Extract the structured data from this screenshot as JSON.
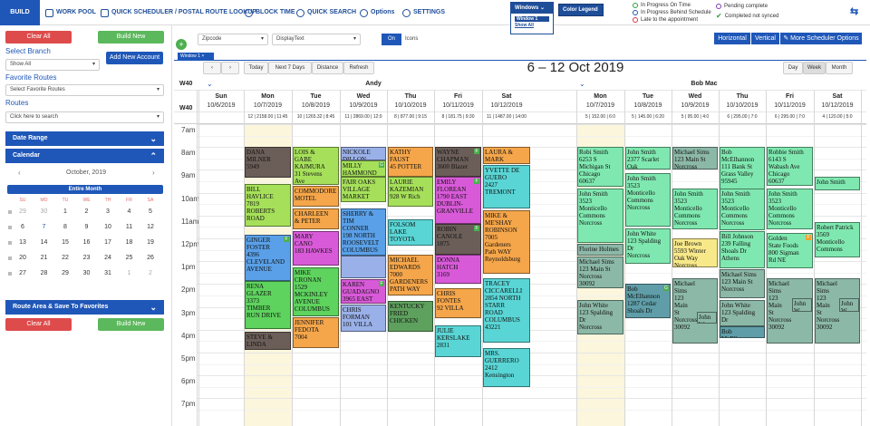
{
  "topnav": {
    "build": "BUILD",
    "items": [
      "WORK POOL",
      "QUICK SCHEDULER / POSTAL ROUTE LOOKUP",
      "BLOCK TIME",
      "QUICK SEARCH",
      "Options",
      "SETTINGS"
    ]
  },
  "windows_popup": {
    "title": "Windows",
    "items": [
      "Window 1",
      "Show All"
    ]
  },
  "color_legend": {
    "title": "Color Legend"
  },
  "status_legend": [
    {
      "text": "In Progress On Time",
      "color": "#2e9e3a"
    },
    {
      "text": "In Progress Behind Schedule",
      "color": "#1f57b8"
    },
    {
      "text": "Late to the appointment",
      "color": "#d9363e"
    },
    {
      "text": "Pending complete",
      "color": "#7a3fb0"
    },
    {
      "text": "Completed not synced",
      "color": "#2e9e3a"
    }
  ],
  "left": {
    "clear_all": "Clear All",
    "build_new": "Build New",
    "select_branch_label": "Select Branch",
    "branch_value": "Show All",
    "add_new_account": "Add New Account",
    "favorite_routes_label": "Favorite Routes",
    "favorite_placeholder": "Select Favorite Routes",
    "routes_label": "Routes",
    "routes_placeholder": "Click here to search",
    "date_range": "Date Range",
    "calendar": "Calendar",
    "month_title": "October, 2019",
    "entire_month": "Entire Month",
    "weekdays": [
      "SU",
      "MO",
      "TU",
      "WE",
      "TH",
      "FR",
      "SA"
    ],
    "weeks": [
      [
        "29",
        "30",
        "1",
        "2",
        "3",
        "4",
        "5"
      ],
      [
        "6",
        "7",
        "8",
        "9",
        "10",
        "11",
        "12"
      ],
      [
        "13",
        "14",
        "15",
        "16",
        "17",
        "18",
        "19"
      ],
      [
        "20",
        "21",
        "22",
        "23",
        "24",
        "25",
        "26"
      ],
      [
        "27",
        "28",
        "29",
        "30",
        "31",
        "1",
        "2"
      ]
    ],
    "route_area_save": "Route Area & Save To Favorites",
    "clear_all_2": "Clear All",
    "build_new_2": "Build New"
  },
  "filter": {
    "zipcode": "Zipcode",
    "displaytext": "DisplayText",
    "on": "On",
    "icons": "Icons",
    "views": [
      "Horizontal",
      "Vertical",
      "More Scheduler Options"
    ]
  },
  "window_tab": "Window 1",
  "calendar_toolbar": {
    "buttons": [
      "Today",
      "Next 7 Days",
      "Distance",
      "Refresh"
    ],
    "title": "6 – 12 Oct 2019",
    "views": [
      "Day",
      "Week",
      "Month"
    ]
  },
  "technicians": [
    {
      "name": "Andy",
      "days": [
        {
          "day": "Sun",
          "date": "10/6/2019",
          "stats": ""
        },
        {
          "day": "Mon",
          "date": "10/7/2019",
          "stats": "12 | 2158.00 | 11:45"
        },
        {
          "day": "Tue",
          "date": "10/8/2019",
          "stats": "10 | 1265.32 | 8:45"
        },
        {
          "day": "Wed",
          "date": "10/9/2019",
          "stats": "11 | 2869.00 | 12:0"
        },
        {
          "day": "Thu",
          "date": "10/10/2019",
          "stats": "8 | 877.00 | 9:15"
        },
        {
          "day": "Fri",
          "date": "10/11/2019",
          "stats": "8 | 181.75 | 9:30"
        },
        {
          "day": "Sat",
          "date": "10/12/2019",
          "stats": "11 | 1487.00 | 14:00"
        }
      ]
    },
    {
      "name": "Bob Mac",
      "days": [
        {
          "day": "Mon",
          "date": "10/7/2019",
          "stats": "5 | 152.00 | 6:0"
        },
        {
          "day": "Tue",
          "date": "10/8/2019",
          "stats": "5 | 145.00 | 6:20"
        },
        {
          "day": "Wed",
          "date": "10/9/2019",
          "stats": "5 | 95.00 | 4:0"
        },
        {
          "day": "Thu",
          "date": "10/10/2019",
          "stats": "6 | 295.00 | 7:0"
        },
        {
          "day": "Fri",
          "date": "10/11/2019",
          "stats": "6 | 295.00 | 7:0"
        },
        {
          "day": "Sat",
          "date": "10/12/2019",
          "stats": "4 | 120.00 | 5:0"
        }
      ]
    }
  ],
  "week_label": "W40",
  "hours": [
    "7am",
    "8am",
    "9am",
    "10am",
    "11am",
    "12pm",
    "1pm",
    "2pm",
    "3pm",
    "4pm",
    "5pm",
    "6pm",
    "7pm"
  ],
  "appointments": [
    {
      "col": 1,
      "start": 8.0,
      "end": 9.35,
      "color": "#6b5e58",
      "text": "DANA\nMILNER\n5949"
    },
    {
      "col": 1,
      "start": 9.6,
      "end": 11.5,
      "color": "#a6e05a",
      "text": "BILL\nHAVLICE\n7819\nROBERTS\nROAD"
    },
    {
      "col": 1,
      "start": 11.85,
      "end": 13.85,
      "color": "#5aa0e8",
      "text": "GINGER\nFOSTER\n4396\nCLEVELAND\nAVENUE",
      "badge": "F"
    },
    {
      "col": 1,
      "start": 13.85,
      "end": 15.95,
      "color": "#5ed35e",
      "text": "RENA\nGLAZER\n3373\nTIMBER\nRUN DRIVE"
    },
    {
      "col": 1,
      "start": 16.1,
      "end": 16.9,
      "color": "#6b5e58",
      "text": "STEVE &\nLINDA"
    },
    {
      "col": 2,
      "start": 8.0,
      "end": 9.65,
      "color": "#a6e05a",
      "text": "LOIS &\nGABE\nKAJMURA\n31 Stevens\nAve"
    },
    {
      "col": 2,
      "start": 9.7,
      "end": 10.6,
      "color": "#f5a64a",
      "text": "COMMODORE\nMOTEL"
    },
    {
      "col": 2,
      "start": 10.7,
      "end": 11.6,
      "color": "#f5a64a",
      "text": "CHARLEEN\n& PETER"
    },
    {
      "col": 2,
      "start": 11.7,
      "end": 13.2,
      "color": "#d85ad8",
      "text": "MARY\nCANO\n183 HAWKES"
    },
    {
      "col": 2,
      "start": 13.25,
      "end": 15.4,
      "color": "#5ed35e",
      "text": "MIKE\nCRONAN\n1529\nMCKINLEY\nAVENUE\nCOLUMBUS"
    },
    {
      "col": 2,
      "start": 15.45,
      "end": 16.8,
      "color": "#f5a64a",
      "text": "JENNIFER\nFEDOTA\n7004"
    },
    {
      "col": 3,
      "start": 8.0,
      "end": 8.6,
      "color": "#9ab0e8",
      "text": "NICKOLE\nDILLON"
    },
    {
      "col": 3,
      "start": 8.6,
      "end": 9.3,
      "color": "#a6e05a",
      "text": "MILLY\nHAMMOND",
      "badge": "G"
    },
    {
      "col": 3,
      "start": 9.3,
      "end": 10.4,
      "color": "#a6e05a",
      "text": "FAIR OAKS\nVILLAGE\nMARKET"
    },
    {
      "col": 3,
      "start": 10.7,
      "end": 12.75,
      "color": "#5aa0e8",
      "text": "SHERRY &\nTIM\nCONNER\n198 NORTH\nROOSEVELT\nCOLUMBUS"
    },
    {
      "col": 3,
      "start": 12.75,
      "end": 13.75,
      "color": "#9ab0e8",
      "text": ""
    },
    {
      "col": 3,
      "start": 13.8,
      "end": 14.85,
      "color": "#d85ad8",
      "text": "KAREN\nGUADAGNO\n3965 EAST\nDUBLIN-",
      "badge": "F"
    },
    {
      "col": 3,
      "start": 14.9,
      "end": 16.1,
      "color": "#9ab0e8",
      "text": "CHRIS\nFORMAN\n101 VILLA"
    },
    {
      "col": 4,
      "start": 8.0,
      "end": 9.3,
      "color": "#f5a64a",
      "text": "KATHY\nFAUST\n45 POTTER"
    },
    {
      "col": 4,
      "start": 9.3,
      "end": 10.6,
      "color": "#a6e05a",
      "text": "LAURIE\nKAZEMIAN\n928 W Rich"
    },
    {
      "col": 4,
      "start": 11.15,
      "end": 12.3,
      "color": "#5ad5d5",
      "text": "FOLSOM\nLAKE\nTOYOTA"
    },
    {
      "col": 4,
      "start": 12.7,
      "end": 14.5,
      "color": "#f5a64a",
      "text": "MICHAEL\nEDWARDS\n7000\nGARDENERS\nPATH WAY"
    },
    {
      "col": 4,
      "start": 14.75,
      "end": 16.1,
      "color": "#5ea05e",
      "text": "KENTUCKY\nFRIED\nCHICKEN"
    },
    {
      "col": 5,
      "start": 8.0,
      "end": 9.3,
      "color": "#6b5e58",
      "text": "WAYNE\nCHAPMAN\n3600 Blazer",
      "badge": "F"
    },
    {
      "col": 5,
      "start": 9.3,
      "end": 11.35,
      "color": "#d85ad8",
      "text": "EMILY\nFLOREAN\n1790 EAST\nDUBLIN-\nGRANVILLE",
      "badge": "F"
    },
    {
      "col": 5,
      "start": 11.35,
      "end": 12.7,
      "color": "#6b5e58",
      "text": "ROBIN\nCANOLE\n1875",
      "badge": "F"
    },
    {
      "col": 5,
      "start": 12.7,
      "end": 14.0,
      "color": "#d85ad8",
      "text": "DONNA\nHATCH\n3169"
    },
    {
      "col": 5,
      "start": 14.2,
      "end": 15.5,
      "color": "#f5a64a",
      "text": "CHRIS\nFONTES\n92 VILLA"
    },
    {
      "col": 5,
      "start": 15.8,
      "end": 17.2,
      "color": "#5ad5d5",
      "text": "JULIE\nKERSLAKE\n2831"
    },
    {
      "col": 6,
      "start": 8.0,
      "end": 8.75,
      "color": "#f5a64a",
      "text": "LAURA &\nMARK"
    },
    {
      "col": 6,
      "start": 8.8,
      "end": 10.7,
      "color": "#5ad5d5",
      "text": "YVETTE DE\nGUERO\n2427\nTREMONT"
    },
    {
      "col": 6,
      "start": 10.75,
      "end": 13.55,
      "color": "#f5a64a",
      "text": "MIKE &\nME'SHAY\nROBINSON\n7005\nGardeners\nPath WAY\nReynoldsburg"
    },
    {
      "col": 6,
      "start": 13.75,
      "end": 16.55,
      "color": "#5ad5d5",
      "text": "TRACEY\nCICCARELLI\n2854 NORTH\nSTARR\nROAD\nCOLUMBUS\n43221"
    },
    {
      "col": 6,
      "start": 16.8,
      "end": 18.5,
      "color": "#5ad5d5",
      "text": "MRS.\nGUERRERO\n2412\nKensington"
    },
    {
      "col": 7,
      "start": 8.0,
      "end": 9.75,
      "color": "#7fe8b0",
      "text": "Robi Smith\n6253 S\nMichigan St\nChicago\n60637"
    },
    {
      "col": 7,
      "start": 9.8,
      "end": 12.2,
      "color": "#7fe8b0",
      "text": "John Smith\n3523\nMonticello\nCommons\nNorcross"
    },
    {
      "col": 7,
      "start": 12.25,
      "end": 12.75,
      "color": "#8cb8a8",
      "text": "Florine Holmes"
    },
    {
      "col": 7,
      "start": 12.8,
      "end": 14.2,
      "color": "#8cb8a8",
      "text": "Michael Sims\n123 Main St\nNorcross\n30092"
    },
    {
      "col": 7,
      "start": 14.7,
      "end": 16.2,
      "color": "#8cb8a8",
      "text": "John White\n123 Spalding\nDr\nNorcross"
    },
    {
      "col": 8,
      "start": 8.0,
      "end": 9.0,
      "color": "#7fe8b0",
      "text": "John Smith\n2377 Scarlet\nOak"
    },
    {
      "col": 8,
      "start": 9.15,
      "end": 11.5,
      "color": "#7fe8b0",
      "text": "John Smith\n3523\nMonticello\nCommons\nNorcross"
    },
    {
      "col": 8,
      "start": 11.55,
      "end": 13.1,
      "color": "#7fe8b0",
      "text": "John White\n123 Spalding\nDr\nNorcross"
    },
    {
      "col": 8,
      "start": 14.0,
      "end": 15.5,
      "color": "#5f9ea8",
      "text": "Bob\nMcElhannon\n1287 Cedar\nShoals Dr",
      "badge": "G"
    },
    {
      "col": 9,
      "start": 8.0,
      "end": 9.0,
      "color": "#8cb8a8",
      "text": "Michael Sims\n123 Main St\nNorcross"
    },
    {
      "col": 9,
      "start": 9.8,
      "end": 11.6,
      "color": "#7fe8b0",
      "text": "John Smith\n3523\nMonticello\nCommons\nNorcross"
    },
    {
      "col": 9,
      "start": 12.0,
      "end": 13.25,
      "color": "#f7e88a",
      "text": "Joe Brown\n5593 Winter\nOak Way\nNorcross"
    },
    {
      "col": 9,
      "start": 13.75,
      "end": 16.6,
      "color": "#8cb8a8",
      "text": "Michael\nSims\n123\nMain\nSt\nNorcross\n30092"
    },
    {
      "col": 9,
      "start": 15.2,
      "end": 15.75,
      "color": "#8cb8a8",
      "text": "John W",
      "half": true
    },
    {
      "col": 10,
      "start": 8.0,
      "end": 11.65,
      "color": "#7fe8b0",
      "text": "Bob\nMcElhannon\n111 Bank St\nGrass Valley\n95945"
    },
    {
      "col": 10,
      "start": 9.8,
      "end": 11.65,
      "color": "#7fe8b0",
      "text": "John Smith\n3523\nMonticello\nCommons\nNorcross"
    },
    {
      "col": 10,
      "start": 11.7,
      "end": 13.3,
      "color": "#7fe8b0",
      "text": "Bill Johnson\n239 Falling\nShoals Dr\nAthens"
    },
    {
      "col": 10,
      "start": 13.35,
      "end": 14.6,
      "color": "#8cb8a8",
      "text": "Michael Sims\n123 Main St\nNorcross"
    },
    {
      "col": 10,
      "start": 14.7,
      "end": 15.85,
      "color": "#8cb8a8",
      "text": "John White\n123 Spalding\nDr"
    },
    {
      "col": 10,
      "start": 15.85,
      "end": 16.35,
      "color": "#5f9ea8",
      "text": "Bob McElhannon"
    },
    {
      "col": 11,
      "start": 8.0,
      "end": 9.7,
      "color": "#7fe8b0",
      "text": "Robbie Smith\n6143 S\nWabash Ave\nChicago\n60637"
    },
    {
      "col": 11,
      "start": 9.8,
      "end": 11.6,
      "color": "#7fe8b0",
      "text": "John Smith\n3523\nMonticello\nCommons\nNorcross"
    },
    {
      "col": 11,
      "start": 11.75,
      "end": 13.3,
      "color": "#7fe8b0",
      "text": "Golden\nState Foods\n800 Sigman\nRd NE",
      "badge": "F",
      "badgeColor": "orange"
    },
    {
      "col": 11,
      "start": 13.75,
      "end": 16.6,
      "color": "#8cb8a8",
      "text": "Michael\nSims\n123\nMain\nSt\nNorcross\n30092"
    },
    {
      "col": 11,
      "start": 14.6,
      "end": 15.2,
      "color": "#8cb8a8",
      "text": "John W",
      "half": true
    },
    {
      "col": 12,
      "start": 9.3,
      "end": 9.9,
      "color": "#7fe8b0",
      "text": "John Smith"
    },
    {
      "col": 12,
      "start": 11.3,
      "end": 12.85,
      "color": "#7fe8b0",
      "text": "Robert Patrick\n3569\nMonticello\nCommons"
    },
    {
      "col": 12,
      "start": 13.75,
      "end": 16.6,
      "color": "#8cb8a8",
      "text": "Michael\nSims\n123\nMain\nSt\nNorcross\n30092"
    },
    {
      "col": 12,
      "start": 14.6,
      "end": 15.2,
      "color": "#8cb8a8",
      "text": "John W",
      "half": true
    }
  ]
}
